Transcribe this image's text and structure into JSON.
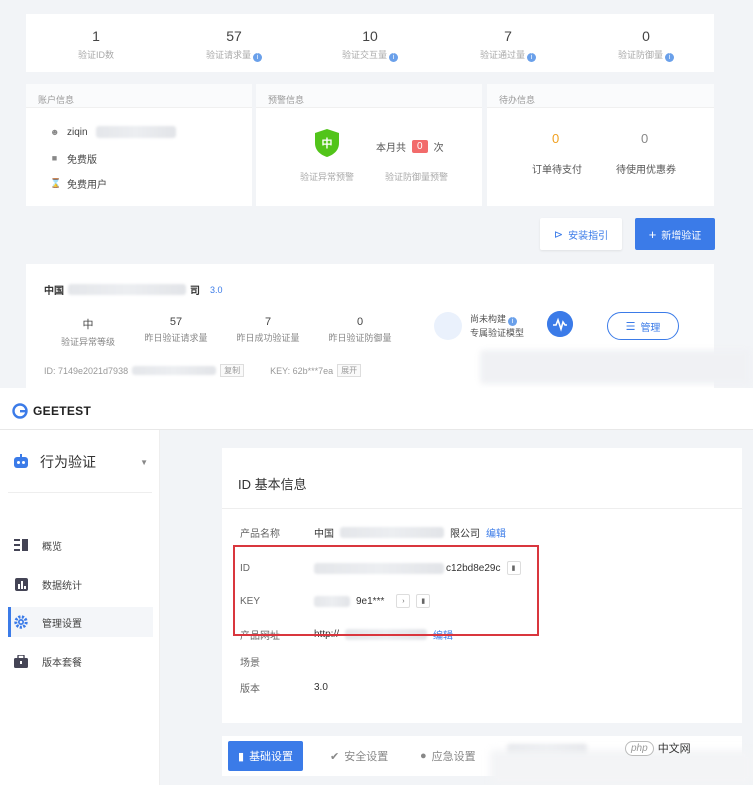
{
  "top": {
    "stats": [
      {
        "value": "1",
        "label": "验证ID数",
        "info": false
      },
      {
        "value": "57",
        "label": "验证请求量",
        "info": true
      },
      {
        "value": "10",
        "label": "验证交互量",
        "info": true
      },
      {
        "value": "7",
        "label": "验证通过量",
        "info": true
      },
      {
        "value": "0",
        "label": "验证防御量",
        "info": true
      }
    ],
    "account": {
      "title": "账户信息",
      "username": "ziqin",
      "plan": "免费版",
      "user_type": "免费用户"
    },
    "warning": {
      "title": "预警信息",
      "level": "中",
      "level_label": "验证异常预警",
      "month_prefix": "本月共",
      "month_count": "0",
      "month_suffix": "次",
      "defense_label": "验证防御量预警"
    },
    "todo": {
      "title": "待办信息",
      "unpaid_count": "0",
      "unpaid_label": "订单待支付",
      "coupon_count": "0",
      "coupon_label": "待使用优惠券"
    },
    "buttons": {
      "guide": "安装指引",
      "new_verify": "新增验证"
    },
    "app": {
      "name_prefix": "中国",
      "name_suffix": "司",
      "version": "3.0",
      "metrics": [
        {
          "value": "中",
          "label": "验证异常等级"
        },
        {
          "value": "57",
          "label": "昨日验证请求量"
        },
        {
          "value": "7",
          "label": "昨日成功验证量"
        },
        {
          "value": "0",
          "label": "昨日验证防御量"
        }
      ],
      "model_line1": "尚未构建",
      "model_line2": "专属验证模型",
      "manage": "管理",
      "id_text": "ID: 7149e2021d7938",
      "copy_tag": "复制",
      "key_text": "KEY: 62b***7ea",
      "show_tag": "展开"
    }
  },
  "bottom": {
    "logo": "GEETEST",
    "product": "行为验证",
    "nav": [
      {
        "label": "概览",
        "icon": "overview-icon"
      },
      {
        "label": "数据统计",
        "icon": "bar-chart-icon"
      },
      {
        "label": "管理设置",
        "icon": "gear-icon"
      },
      {
        "label": "版本套餐",
        "icon": "package-icon"
      }
    ],
    "active_nav": "管理设置",
    "info": {
      "title": "ID 基本信息",
      "product_name_key": "产品名称",
      "product_name_prefix": "中国",
      "product_name_suffix": "限公司",
      "edit": "编辑",
      "id_key": "ID",
      "id_value": "c12bd8e29c",
      "key_key": "KEY",
      "key_value": "9e1***",
      "url_key": "产品网址",
      "url_value": "http://",
      "scene_key": "场景",
      "version_key": "版本",
      "version_value": "3.0"
    },
    "tabs": [
      {
        "label": "基础设置",
        "active": true
      },
      {
        "label": "安全设置",
        "active": false
      },
      {
        "label": "应急设置",
        "active": false
      }
    ]
  },
  "watermark": {
    "brand": "php",
    "site": "中文网"
  },
  "colors": {
    "accent": "#3b7be8",
    "warn_green": "#52c41a",
    "todo_orange": "#f0a020",
    "badge_red": "#f26b6b",
    "highlight_red": "#d9363e"
  }
}
